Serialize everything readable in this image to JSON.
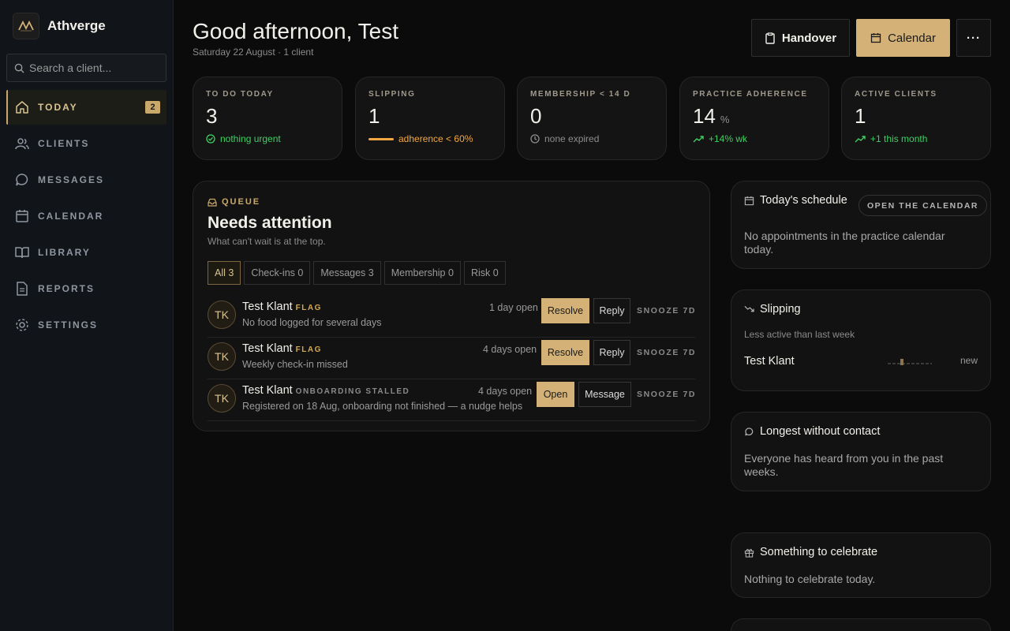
{
  "app": {
    "name": "Athverge"
  },
  "search": {
    "placeholder": "Search a client..."
  },
  "nav": {
    "items": [
      {
        "label": "TODAY",
        "icon": "home-icon",
        "badge": "2",
        "active": true
      },
      {
        "label": "CLIENTS",
        "icon": "users-icon"
      },
      {
        "label": "MESSAGES",
        "icon": "chat-icon"
      },
      {
        "label": "CALENDAR",
        "icon": "calendar-icon"
      },
      {
        "label": "LIBRARY",
        "icon": "book-icon"
      },
      {
        "label": "REPORTS",
        "icon": "file-icon"
      },
      {
        "label": "SETTINGS",
        "icon": "gear-icon"
      }
    ]
  },
  "header": {
    "greeting": "Good afternoon, Test",
    "subtitle": "Saturday 22 August · 1 client",
    "handover_label": "Handover",
    "calendar_label": "Calendar",
    "more_label": "···"
  },
  "stats": [
    {
      "label": "TO DO TODAY",
      "value": "3",
      "unit": "",
      "note": "nothing urgent",
      "note_color": "green",
      "icon": "check-circle-icon"
    },
    {
      "label": "SLIPPING",
      "value": "1",
      "unit": "",
      "note": "adherence < 60%",
      "note_color": "orange",
      "icon": "bar-icon"
    },
    {
      "label": "MEMBERSHIP < 14 D",
      "value": "0",
      "unit": "",
      "note": "none expired",
      "note_color": "grey",
      "icon": "clock-icon"
    },
    {
      "label": "PRACTICE ADHERENCE",
      "value": "14",
      "unit": "%",
      "note": "+14% wk",
      "note_color": "green",
      "icon": "trend-up-icon"
    },
    {
      "label": "ACTIVE CLIENTS",
      "value": "1",
      "unit": "",
      "note": "+1 this month",
      "note_color": "green",
      "icon": "trend-up-icon"
    }
  ],
  "queue": {
    "kicker": "QUEUE",
    "title": "Needs attention",
    "subtitle": "What can't wait is at the top.",
    "tabs": [
      "All 3",
      "Check-ins 0",
      "Messages 3",
      "Membership 0",
      "Risk 0"
    ],
    "rows": [
      {
        "initials": "TK",
        "name": "Test Klant",
        "flag": "FLAG",
        "desc": "No food logged for several days",
        "open": "1 day open",
        "primary": "Resolve",
        "secondary": "Reply",
        "snooze": "SNOOZE 7D"
      },
      {
        "initials": "TK",
        "name": "Test Klant",
        "flag": "FLAG",
        "desc": "Weekly check-in missed",
        "open": "4 days open",
        "primary": "Resolve",
        "secondary": "Reply",
        "snooze": "SNOOZE 7D"
      },
      {
        "initials": "TK",
        "name": "Test Klant",
        "flag": "ONBOARDING STALLED",
        "desc": "Registered on 18 Aug, onboarding not finished — a nudge helps",
        "open": "4 days open",
        "primary": "Open",
        "secondary": "Message",
        "snooze": "SNOOZE 7D"
      }
    ]
  },
  "schedule": {
    "title": "Today's schedule",
    "action": "OPEN THE CALENDAR",
    "body": "No appointments in the practice calendar today."
  },
  "slipping": {
    "title": "Slipping",
    "subtitle": "Less active than last week",
    "client": "Test Klant",
    "status": "new"
  },
  "contact": {
    "title": "Longest without contact",
    "body": "Everyone has heard from you in the past weeks."
  },
  "celebrate": {
    "title": "Something to celebrate",
    "body": "Nothing to celebrate today."
  },
  "colors": {
    "accent": "#d4b277",
    "green": "#3fd062",
    "orange": "#f2a742",
    "background": "#0b0b0b"
  }
}
